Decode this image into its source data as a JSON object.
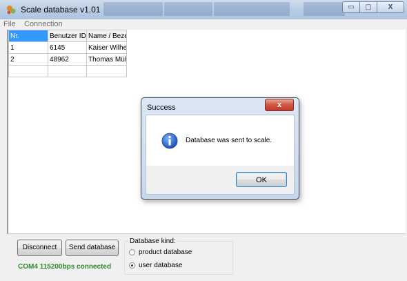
{
  "window": {
    "title": "Scale database v1.01",
    "controls": {
      "minimize": "▭",
      "maximize": "▢",
      "close": "X"
    }
  },
  "menu": {
    "items": [
      "File",
      "Connection"
    ]
  },
  "table": {
    "columns": [
      "Nr.",
      "Benutzer ID",
      "Name / Beze"
    ],
    "rows": [
      [
        "1",
        "6145",
        "Kaiser Wilhel"
      ],
      [
        "2",
        "48962",
        "Thomas Müll"
      ],
      [
        "",
        "",
        ""
      ]
    ]
  },
  "dialog": {
    "title": "Success",
    "close_label": "x",
    "message": "Database was sent to scale.",
    "ok_label": "OK",
    "icon": "info-icon"
  },
  "bottom": {
    "disconnect_label": "Disconnect",
    "send_label": "Send database",
    "status": "COM4 115200bps connected",
    "database_kind": {
      "legend": "Database kind:",
      "options": [
        "product database",
        "user database"
      ],
      "selected": "user database"
    }
  },
  "colors": {
    "selected_header": "#3399ff",
    "status_text": "#2e8b2e"
  }
}
